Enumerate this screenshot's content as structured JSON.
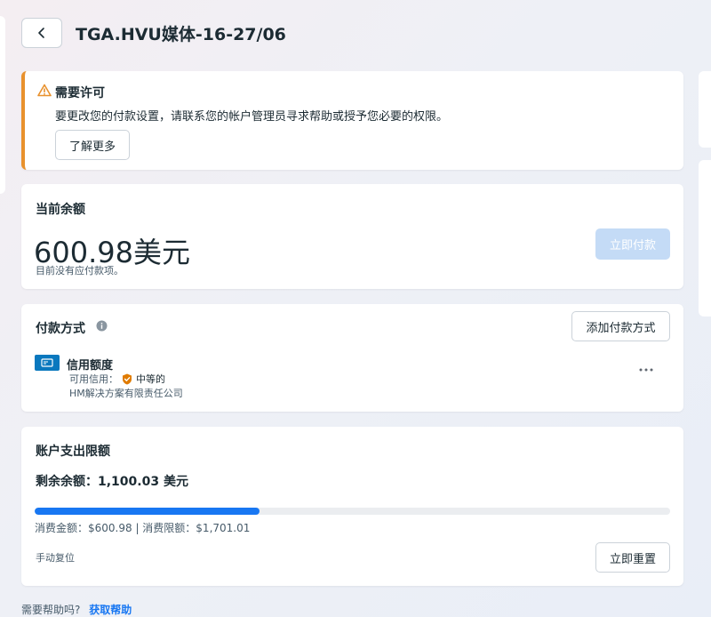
{
  "header": {
    "title": "TGA.HVU媒体-16-27/06"
  },
  "warning": {
    "title": "需要许可",
    "message": "要更改您的付款设置，请联系您的帐户管理员寻求帮助或授予您必要的权限。",
    "learn_more": "了解更多"
  },
  "balance": {
    "title": "当前余额",
    "amount": "600.98美元",
    "note": "目前没有应付款项。",
    "pay_now": "立即付款"
  },
  "payment_method": {
    "title": "付款方式",
    "add_button": "添加付款方式",
    "method_name": "信用额度",
    "available_label": "可用信用：",
    "available_level": "中等的",
    "company": "HM解决方案有限责任公司"
  },
  "spending_limit": {
    "title": "账户支出限额",
    "remaining": "剩余余额：1,100.03 美元",
    "spent_fraction": 0.3533,
    "spend_text": "消费金额：$600.98 | 消费限额：$1,701.01",
    "manual_reset": "手动复位",
    "reset_button": "立即重置"
  },
  "help": {
    "question": "需要帮助吗?",
    "link": "获取帮助"
  },
  "colors": {
    "accent": "#1877f2",
    "warning": "#e8912d",
    "pay_disabled": "#c4dbf6"
  }
}
